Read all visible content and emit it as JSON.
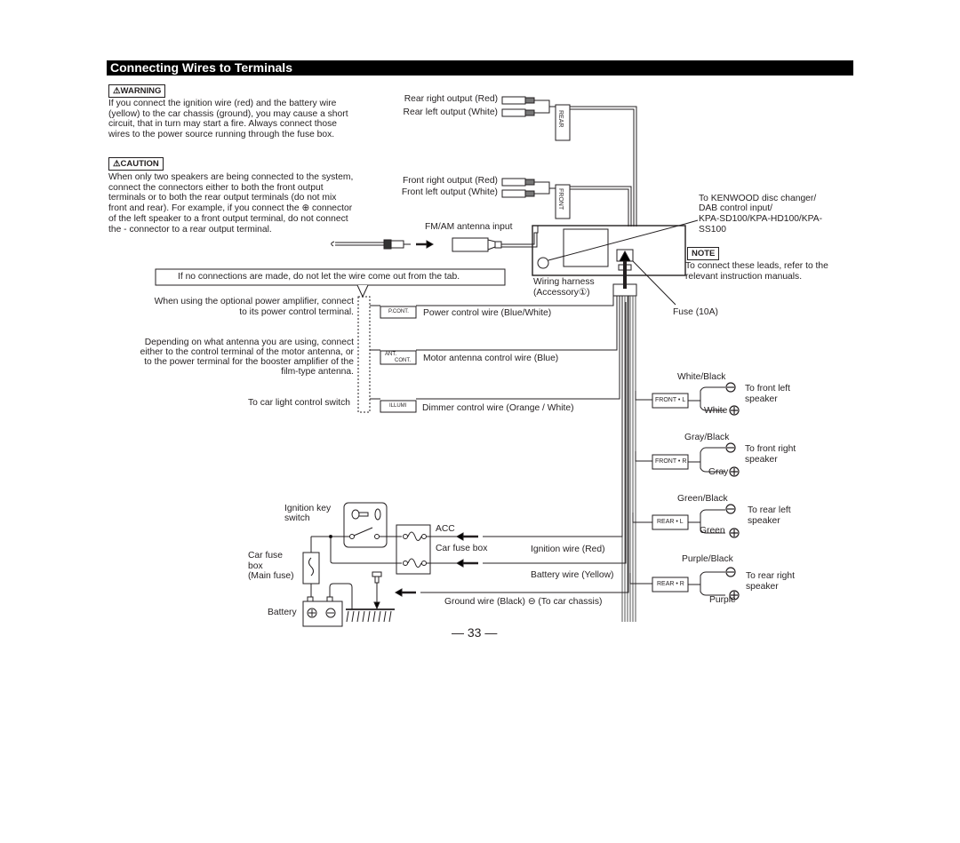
{
  "title": "Connecting Wires to Terminals",
  "warning": {
    "label": "⚠WARNING",
    "text": "If you connect the ignition wire (red) and the battery wire (yellow) to the car chassis (ground), you may cause a short circuit, that in turn may start a fire. Always connect those wires to the power source running through the fuse box."
  },
  "caution": {
    "label": "⚠CAUTION",
    "text": "When only two speakers are being connected to the system, connect the connectors either to both the front output terminals or to both the rear output terminals (do not mix front and rear). For example, if you connect the ⊕ connector of the left speaker to a front output terminal, do not connect the - connector to a rear output terminal."
  },
  "outputs": {
    "rear_right": "Rear right output (Red)",
    "rear_left": "Rear left output (White)",
    "rear_tag": "REAR",
    "front_right": "Front right output (Red)",
    "front_left": "Front left output (White)",
    "front_tag": "FRONT",
    "antenna": "FM/AM antenna input"
  },
  "changer": {
    "text1": "To KENWOOD disc changer/",
    "text2": "DAB control input/",
    "text3": "KPA-SD100/KPA-HD100/KPA-",
    "text4": "SS100"
  },
  "note": {
    "label": "NOTE",
    "line1": "To connect these leads, refer to the",
    "line2": "relevant instruction manuals."
  },
  "fuse": "Fuse (10A)",
  "tab_note": "If no connections are made, do not let the wire come out from the tab.",
  "harness": {
    "line1": "Wiring harness",
    "line2": "(Accessory①)"
  },
  "left_notes": {
    "amp1": "When using the optional power amplifier, connect",
    "amp2": "to its power control terminal.",
    "ant1": "Depending on what antenna you are using, connect",
    "ant2": "either to the control terminal of the motor antenna, or",
    "ant3": "to the power terminal for the booster amplifier of the",
    "ant4": "film-type antenna.",
    "light": "To car light control switch"
  },
  "control_wires": [
    {
      "tag": "P.CONT.",
      "label": "Power control wire (Blue/White)"
    },
    {
      "tag": "ANT. CONT.",
      "tag1": "ANT.",
      "tag2": "CONT.",
      "label": "Motor antenna control wire (Blue)"
    },
    {
      "tag": "ILLUMI",
      "label": "Dimmer control wire (Orange / White)"
    }
  ],
  "speakers": [
    {
      "tag": "FRONT • L",
      "neg": "White/Black",
      "pos": "White",
      "dest1": "To front left",
      "dest2": "speaker"
    },
    {
      "tag": "FRONT • R",
      "neg": "Gray/Black",
      "pos": "Gray",
      "dest1": "To front right",
      "dest2": "speaker"
    },
    {
      "tag": "REAR • L",
      "neg": "Green/Black",
      "pos": "Green",
      "dest1": "To rear left",
      "dest2": "speaker"
    },
    {
      "tag": "REAR • R",
      "neg": "Purple/Black",
      "pos": "Purple",
      "dest1": "To rear right",
      "dest2": "speaker"
    }
  ],
  "power": {
    "ignition_key1": "Ignition key",
    "ignition_key2": "switch",
    "acc": "ACC",
    "car_fuse_box": "Car fuse box",
    "main_fuse1": "Car fuse",
    "main_fuse2": "box",
    "main_fuse3": "(Main fuse)",
    "battery": "Battery",
    "ignition_wire": "Ignition wire (Red)",
    "battery_wire": "Battery wire (Yellow)",
    "ground_wire": "Ground wire (Black) ⊖ (To car chassis)"
  },
  "page_number": "— 33 —"
}
